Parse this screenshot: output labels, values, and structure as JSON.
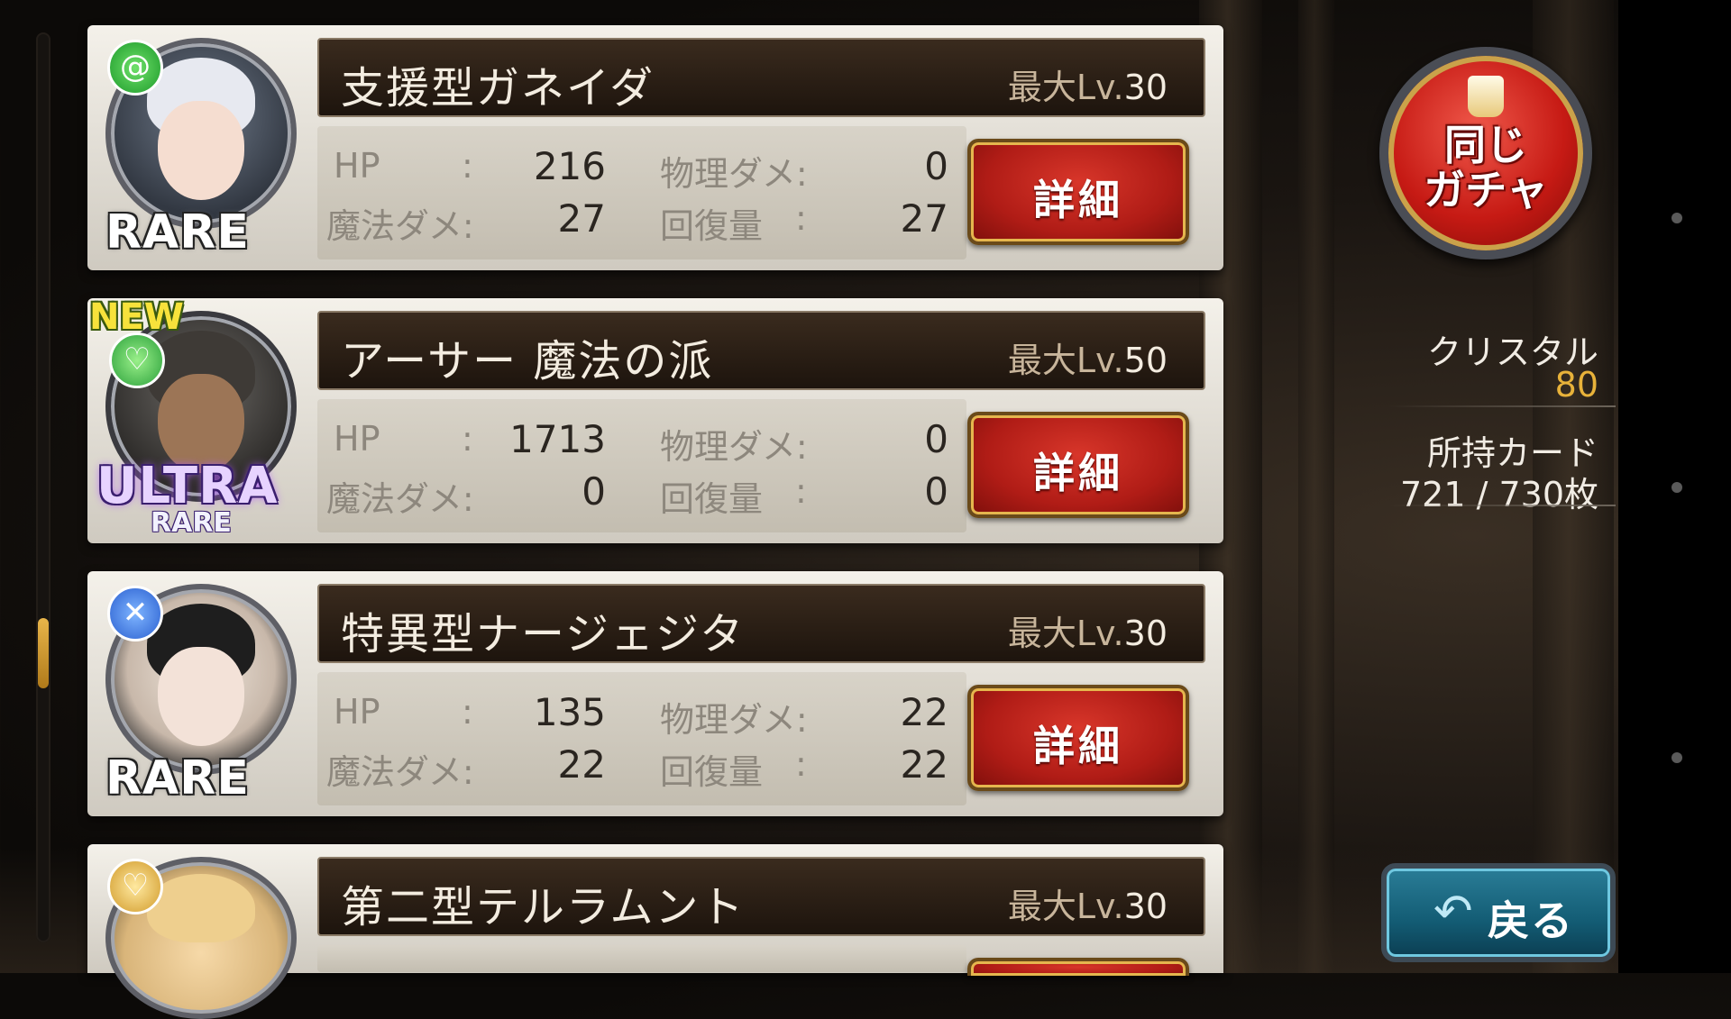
{
  "cards": [
    {
      "name": "支援型ガネイダ",
      "lv_prefix": "最大Lv.",
      "lv": "30",
      "element": "wind",
      "rarity": "RARE",
      "is_new": false,
      "hp": "216",
      "phys": "0",
      "magic": "27",
      "heal": "27"
    },
    {
      "name": "アーサー 魔法の派",
      "lv_prefix": "最大Lv.",
      "lv": "50",
      "element": "heart",
      "rarity": "ULTRA",
      "rarity_sub": "RARE",
      "new_label": "NEW",
      "is_new": true,
      "hp": "1713",
      "phys": "0",
      "magic": "0",
      "heal": "0"
    },
    {
      "name": "特異型ナージェジタ",
      "lv_prefix": "最大Lv.",
      "lv": "30",
      "element": "sword",
      "rarity": "RARE",
      "is_new": false,
      "hp": "135",
      "phys": "22",
      "magic": "22",
      "heal": "22"
    },
    {
      "name": "第二型テルラムント",
      "lv_prefix": "最大Lv.",
      "lv": "30",
      "element": "heart-gold",
      "is_new": false
    }
  ],
  "labels": {
    "hp": "HP",
    "colon": ":",
    "phys": "物理ダメ:",
    "magic": "魔法ダメ:",
    "heal": "回復量",
    "detail": "詳細"
  },
  "side": {
    "gacha_line1": "同じ",
    "gacha_line2": "ガチャ",
    "crystal_label": "クリスタル",
    "crystal_value": "80",
    "cards_label": "所持カード",
    "cards_value": "721 / 730枚",
    "back_label": "戻る"
  },
  "icons": {
    "wind": "wind-element-icon",
    "heart": "heart-element-icon",
    "sword": "sword-element-icon",
    "heart_gold": "heart-gold-element-icon",
    "back": "back-arrow-icon",
    "gacha": "gacha-cup-icon"
  },
  "colors": {
    "crystal_value": "#e8b23a",
    "detail_button": "#c41e18",
    "back_button": "#1a6a84",
    "accent_gold": "#e5b64e"
  }
}
